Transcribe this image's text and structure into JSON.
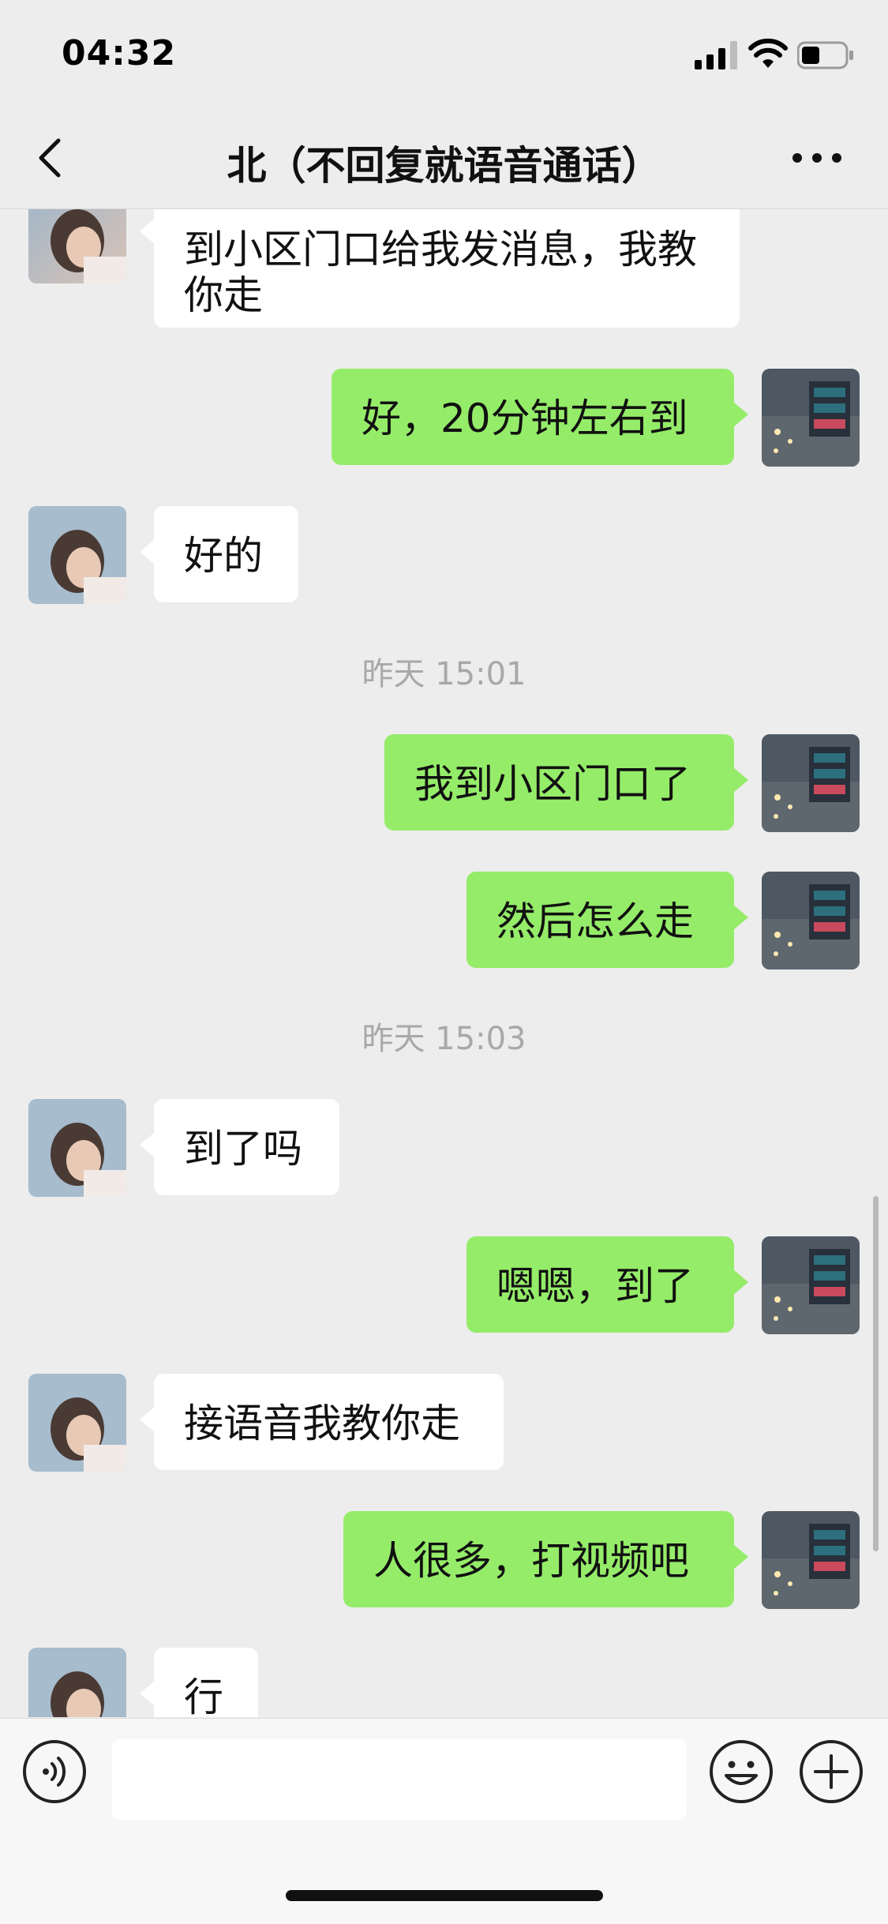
{
  "status_bar": {
    "time": "04:32"
  },
  "nav": {
    "title": "北（不回复就语音通话）"
  },
  "messages": [
    {
      "side": "left",
      "text": "到小区门口给我发消息，我教你走"
    },
    {
      "side": "right",
      "text": "好，20分钟左右到"
    },
    {
      "side": "left",
      "text": "好的"
    },
    {
      "type": "timestamp",
      "text": "昨天 15:01"
    },
    {
      "side": "right",
      "text": "我到小区门口了"
    },
    {
      "side": "right",
      "text": "然后怎么走"
    },
    {
      "type": "timestamp",
      "text": "昨天 15:03"
    },
    {
      "side": "left",
      "text": "到了吗"
    },
    {
      "side": "right",
      "text": "嗯嗯，到了"
    },
    {
      "side": "left",
      "text": "接语音我教你走"
    },
    {
      "side": "right",
      "text": "人很多，打视频吧"
    },
    {
      "side": "left",
      "text": "行"
    }
  ],
  "input": {
    "placeholder": ""
  },
  "colors": {
    "background": "#ededed",
    "sent_bubble": "#95ec69",
    "received_bubble": "#ffffff"
  },
  "icons": {
    "back": "chevron-left-icon",
    "more": "more-dots-icon",
    "voice": "voice-icon",
    "emoji": "emoji-icon",
    "plus": "plus-icon"
  }
}
